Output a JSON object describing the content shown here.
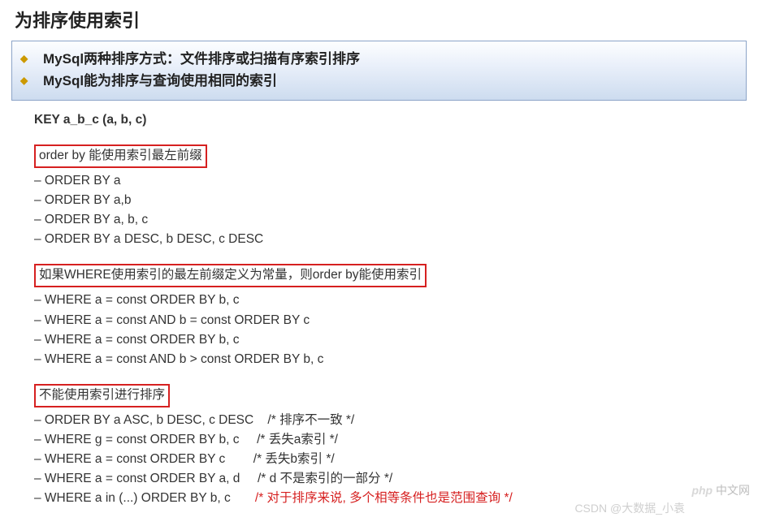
{
  "title": "为排序使用索引",
  "summary": {
    "line1": "MySql两种排序方式：文件排序或扫描有序索引排序",
    "line2": "MySql能为排序与查询使用相同的索引"
  },
  "key_def": "KEY a_b_c (a, b, c)",
  "section1": {
    "header": "order by 能使用索引最左前缀",
    "items": [
      "– ORDER BY a",
      "– ORDER BY a,b",
      "– ORDER BY a, b, c",
      "– ORDER BY a DESC, b DESC, c DESC"
    ]
  },
  "section2": {
    "header": "如果WHERE使用索引的最左前缀定义为常量，则order by能使用索引",
    "items": [
      "– WHERE a = const ORDER BY b, c",
      "– WHERE a = const AND b = const ORDER BY c",
      "– WHERE a = const ORDER BY b, c",
      "– WHERE a = const AND b > const ORDER BY b, c"
    ]
  },
  "section3": {
    "header": "不能使用索引进行排序",
    "rows": [
      {
        "code": "– ORDER BY a ASC, b DESC, c DESC    ",
        "comment": "/* 排序不一致 */",
        "red": false
      },
      {
        "code": "– WHERE g = const ORDER BY b, c     ",
        "comment": "/* 丢失a索引 */",
        "red": false
      },
      {
        "code": "– WHERE a = const ORDER BY c        ",
        "comment": "/* 丢失b索引 */",
        "red": false
      },
      {
        "code": "– WHERE a = const ORDER BY a, d     ",
        "comment": "/* d 不是索引的一部分 */",
        "red": false
      },
      {
        "code": "– WHERE a in (...) ORDER BY b, c       ",
        "comment": "/* 对于排序来说, 多个相等条件也是范围查询 */",
        "red": true
      }
    ]
  },
  "watermark": {
    "php": "php",
    "cn": " 中文网"
  },
  "csdn": "CSDN @大数据_小袁"
}
